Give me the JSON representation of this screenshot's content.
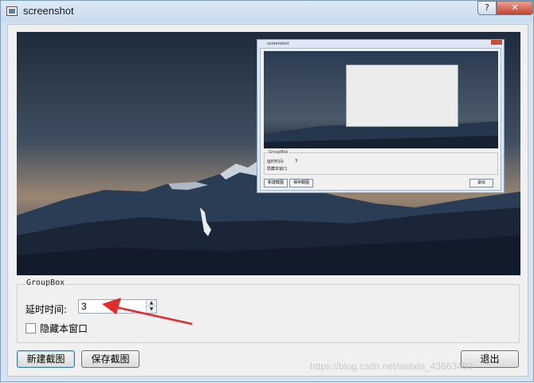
{
  "window": {
    "title": "screenshot",
    "help_label": "?",
    "close_label": "✕"
  },
  "preview": {
    "inner_window_title": "screenshot",
    "inner_groupbox": "GroupBox",
    "inner_delay_label": "延时时间:",
    "inner_delay_value": "3",
    "inner_checkbox_label": "隐藏本窗口",
    "inner_new_button": "新建截图",
    "inner_save_button": "保存截图",
    "inner_exit_button": "退出"
  },
  "groupbox": {
    "title": "GroupBox",
    "delay_label": "延时时间:",
    "delay_value": "3",
    "hide_label": "隐藏本窗口"
  },
  "buttons": {
    "new": "新建截图",
    "save": "保存截图",
    "exit": "退出"
  },
  "watermark": "https://blog.csdn.net/weixin_43663493",
  "colors": {
    "annotation_arrow": "#e22b2b",
    "sky_top": "#1f2c3f",
    "sky_horizon": "#c8a27d",
    "mountain": "#23344b"
  }
}
